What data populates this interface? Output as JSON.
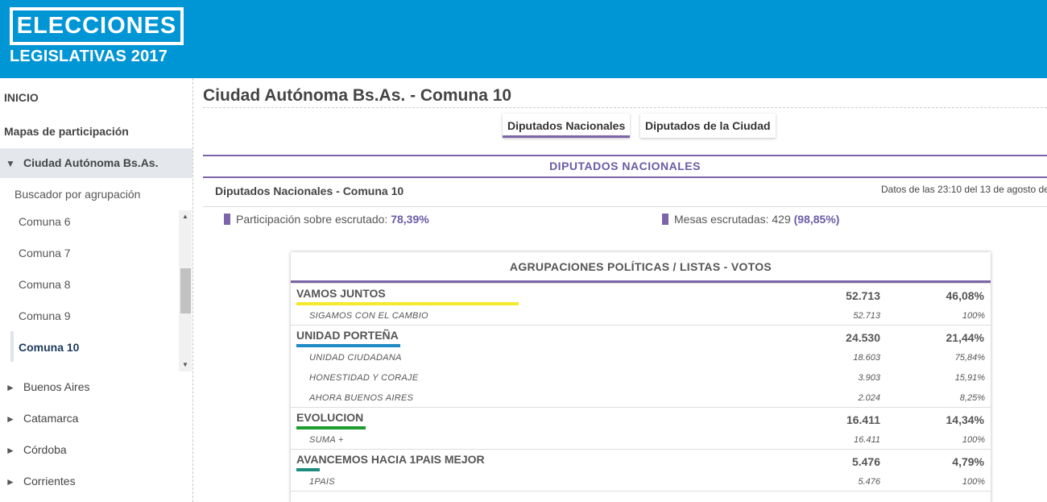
{
  "logo": {
    "line1": "ELECCIONES",
    "line2": "LEGISLATIVAS 2017"
  },
  "sidebar": {
    "inicio": "INICIO",
    "mapas": "Mapas de participación",
    "current": "Ciudad Autónoma Bs.As.",
    "buscador": "Buscador por agrupación",
    "comunas": [
      "Comuna 6",
      "Comuna 7",
      "Comuna 8",
      "Comuna 9",
      "Comuna 10"
    ],
    "active_comuna": "Comuna 10",
    "provinces": [
      "Buenos Aires",
      "Catamarca",
      "Córdoba",
      "Corrientes"
    ]
  },
  "main": {
    "title": "Ciudad Autónoma Bs.As. - Comuna 10",
    "tabs": [
      "Diputados Nacionales",
      "Diputados de la Ciudad"
    ],
    "active_tab": "Diputados Nacionales",
    "section_header": "DIPUTADOS NACIONALES",
    "subtitle": "Diputados Nacionales - Comuna 10",
    "data_time": "Datos de las 23:10 del 13 de agosto de",
    "participation_label": "Participación sobre escrutado:",
    "participation_value": "78,39%",
    "mesas_label": "Mesas escrutadas: 429",
    "mesas_value": "(98,85%)",
    "table_header": "AGRUPACIONES POLÍTICAS / LISTAS - VOTOS",
    "parties": [
      {
        "name": "VAMOS JUNTOS",
        "votes": "52.713",
        "pct": "46,08%",
        "color": "#f5e92a",
        "share": 0.4608,
        "lists": [
          {
            "name": "SIGAMOS CON EL CAMBIO",
            "votes": "52.713",
            "pct": "100%"
          }
        ]
      },
      {
        "name": "UNIDAD PORTEÑA",
        "votes": "24.530",
        "pct": "21,44%",
        "color": "#1f8ac6",
        "share": 0.2144,
        "lists": [
          {
            "name": "UNIDAD CIUDADANA",
            "votes": "18.603",
            "pct": "75,84%"
          },
          {
            "name": "HONESTIDAD Y CORAJE",
            "votes": "3.903",
            "pct": "15,91%"
          },
          {
            "name": "AHORA BUENOS AIRES",
            "votes": "2.024",
            "pct": "8,25%"
          }
        ]
      },
      {
        "name": "EVOLUCION",
        "votes": "16.411",
        "pct": "14,34%",
        "color": "#1e9e2f",
        "share": 0.1434,
        "lists": [
          {
            "name": "SUMA +",
            "votes": "16.411",
            "pct": "100%"
          }
        ]
      },
      {
        "name": "AVANCEMOS HACIA 1PAIS MEJOR",
        "votes": "5.476",
        "pct": "4,79%",
        "color": "#1c8c7e",
        "share": 0.0479,
        "lists": [
          {
            "name": "1PAIS",
            "votes": "5.476",
            "pct": "100%"
          }
        ]
      }
    ]
  }
}
